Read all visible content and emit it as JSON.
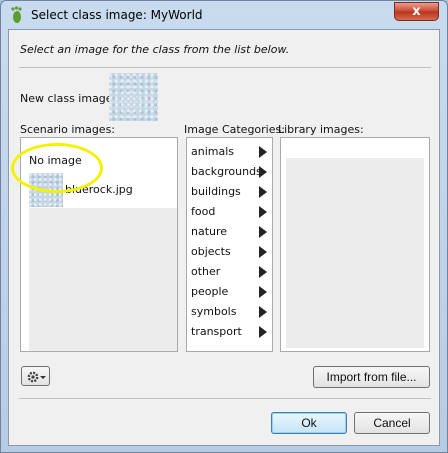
{
  "window": {
    "title": "Select class image: MyWorld",
    "close_symbol": "x"
  },
  "dialog": {
    "instruction": "Select an image for the class from the list below.",
    "new_class_image_label": "New class image:",
    "scenario_images_label": "Scenario images:",
    "image_categories_label": "Image Categories:",
    "library_images_label": "Library images:"
  },
  "scenario_images": {
    "items": [
      {
        "label": "No image"
      },
      {
        "label": "bluerock.jpg",
        "icon": "image-thumbnail"
      }
    ]
  },
  "categories": [
    {
      "label": "animals"
    },
    {
      "label": "backgrounds"
    },
    {
      "label": "buildings"
    },
    {
      "label": "food"
    },
    {
      "label": "nature"
    },
    {
      "label": "objects"
    },
    {
      "label": "other"
    },
    {
      "label": "people"
    },
    {
      "label": "symbols"
    },
    {
      "label": "transport"
    }
  ],
  "buttons": {
    "import": "Import from file...",
    "ok": "Ok",
    "cancel": "Cancel",
    "settings_icon": "gear-icon"
  },
  "colors": {
    "highlight": "#f4f200",
    "close_button": "#c8432b"
  }
}
